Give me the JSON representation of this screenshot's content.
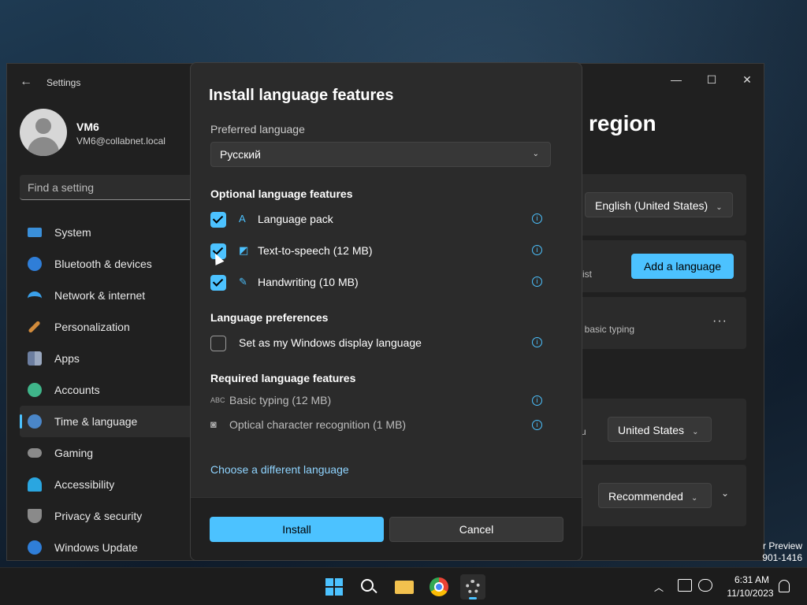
{
  "settings": {
    "title": "Settings",
    "user": {
      "name": "VM6",
      "email": "VM6@collabnet.local"
    },
    "search_placeholder": "Find a setting",
    "nav": [
      {
        "label": "System",
        "icon": "system-icon"
      },
      {
        "label": "Bluetooth & devices",
        "icon": "bluetooth-icon"
      },
      {
        "label": "Network & internet",
        "icon": "wifi-icon"
      },
      {
        "label": "Personalization",
        "icon": "brush-icon"
      },
      {
        "label": "Apps",
        "icon": "apps-icon"
      },
      {
        "label": "Accounts",
        "icon": "person-icon"
      },
      {
        "label": "Time & language",
        "icon": "globe-clock-icon",
        "active": true
      },
      {
        "label": "Gaming",
        "icon": "gamepad-icon"
      },
      {
        "label": "Accessibility",
        "icon": "accessibility-icon"
      },
      {
        "label": "Privacy & security",
        "icon": "shield-icon"
      },
      {
        "label": "Windows Update",
        "icon": "update-icon"
      }
    ],
    "background": {
      "heading_fragment": "region",
      "display_language": "English (United States)",
      "add_language": "Add a language",
      "list_fragment": "ist",
      "typing_fragment": ", basic typing",
      "country": "United States",
      "format": "Recommended",
      "country_fragment": "u"
    }
  },
  "dialog": {
    "title": "Install language features",
    "preferred_label": "Preferred language",
    "preferred_value": "Русский",
    "optional_heading": "Optional language features",
    "optional": [
      {
        "label": "Language pack",
        "checked": true,
        "icon": "language-pack-icon"
      },
      {
        "label": "Text-to-speech (12 MB)",
        "checked": true,
        "icon": "speech-icon"
      },
      {
        "label": "Handwriting (10 MB)",
        "checked": true,
        "icon": "handwriting-icon"
      }
    ],
    "prefs_heading": "Language preferences",
    "display_pref": {
      "label": "Set as my Windows display language",
      "checked": false
    },
    "required_heading": "Required language features",
    "required": [
      {
        "label": "Basic typing (12 MB)",
        "icon": "abc-icon"
      },
      {
        "label": "Optical character recognition (1 MB)",
        "icon": "ocr-icon"
      }
    ],
    "link": "Choose a different language",
    "install": "Install",
    "cancel": "Cancel"
  },
  "watermark": {
    "line1": "r Preview",
    "line2": "901-1416"
  },
  "taskbar": {
    "time": "6:31 AM",
    "date": "11/10/2023"
  },
  "colors": {
    "accent": "#4cc2ff",
    "window": "#202020",
    "dialog": "#2b2b2b"
  }
}
